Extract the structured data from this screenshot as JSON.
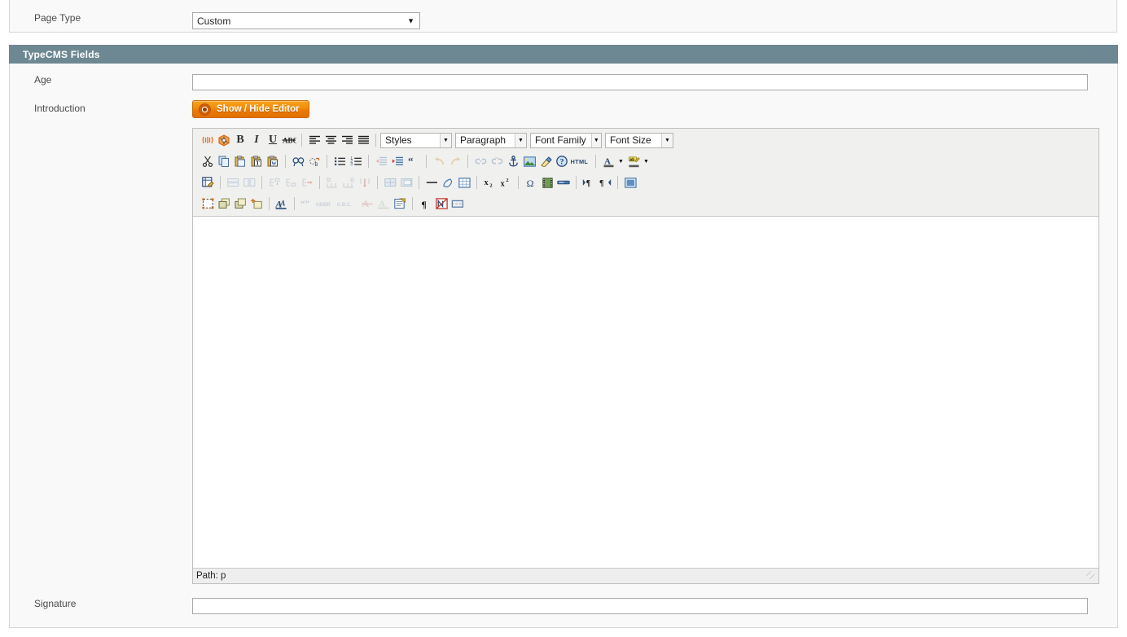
{
  "page_type_row": {
    "label": "Page Type",
    "selected": "Custom",
    "options": [
      "Custom"
    ]
  },
  "section": {
    "title": "TypeCMS Fields"
  },
  "fields": {
    "age": {
      "label": "Age",
      "value": "",
      "placeholder": ""
    },
    "introduction": {
      "label": "Introduction"
    },
    "signature": {
      "label": "Signature",
      "value": "",
      "placeholder": ""
    }
  },
  "editor": {
    "toggle_button": "Show / Hide Editor",
    "status": "Path: p",
    "selects": [
      {
        "name": "styles",
        "label": "Styles"
      },
      {
        "name": "format",
        "label": "Paragraph"
      },
      {
        "name": "fontfamily",
        "label": "Font Family"
      },
      {
        "name": "fontsize",
        "label": "Font Size"
      }
    ],
    "row1_icons": [
      "visual-chars-icon",
      "visual-blocks-icon",
      "bold-icon",
      "italic-icon",
      "underline-icon",
      "strikethrough-icon",
      "align-left-icon",
      "align-center-icon",
      "align-right-icon",
      "align-justify-icon"
    ],
    "row2_icons": [
      "cut-icon",
      "copy-icon",
      "paste-icon",
      "paste-text-icon",
      "paste-word-icon",
      "search-icon",
      "replace-icon",
      "bullist-icon",
      "numlist-icon",
      "outdent-icon",
      "indent-icon",
      "blockquote-icon",
      "undo-icon",
      "redo-icon",
      "link-icon",
      "unlink-icon",
      "anchor-icon",
      "image-icon",
      "cleanup-icon",
      "help-icon",
      "html-source-icon",
      "forecolor-icon",
      "forecolor-picker-icon",
      "backcolor-icon",
      "backcolor-picker-icon"
    ],
    "row3_icons": [
      "table-props-icon",
      "row-props-icon",
      "cell-props-icon",
      "row-before-icon",
      "row-after-icon",
      "delete-row-icon",
      "col-before-icon",
      "col-after-icon",
      "delete-col-icon",
      "split-cells-icon",
      "merge-cells-icon",
      "horizontal-rule-icon",
      "remove-format-icon",
      "visual-aid-icon",
      "subscript-icon",
      "superscript-icon",
      "charmap-icon",
      "media-icon",
      "pagebreak-icon",
      "ltr-icon",
      "rtl-icon",
      "fullscreen-icon"
    ],
    "row4_icons": [
      "insert-layer-icon",
      "move-forward-icon",
      "move-backward-icon",
      "absolute-position-icon",
      "styleprops-icon",
      "cite-icon",
      "abbr-icon",
      "acronym-icon",
      "del-icon",
      "ins-icon",
      "attribs-icon",
      "invisible-elements-icon",
      "nonbreaking-icon",
      "pagebreak2-icon"
    ]
  },
  "colors": {
    "section_header_bg": "#6d8892",
    "panel_bg": "#f9f9f9",
    "panel_border": "#d6d6d6",
    "button_orange": "#ee7d06",
    "toolbar_bg": "#f0f0ee"
  }
}
